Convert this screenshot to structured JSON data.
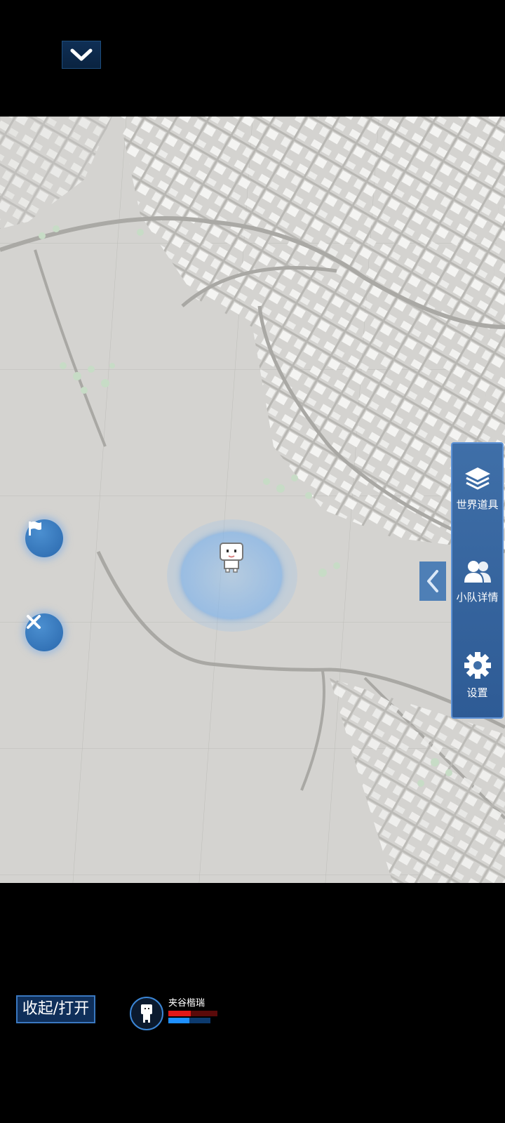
{
  "top": {
    "collapse_icon": "chevron-down-icon"
  },
  "map": {
    "player_marker": "player-avatar",
    "left_buttons": [
      {
        "name": "flag-button",
        "icon": "flag-icon"
      },
      {
        "name": "close-button",
        "icon": "close-icon"
      }
    ]
  },
  "side_panel": {
    "items": [
      {
        "label": "世界道具",
        "icon": "layers-icon"
      },
      {
        "label": "小队详情",
        "icon": "team-icon"
      },
      {
        "label": "设置",
        "icon": "gear-icon"
      }
    ],
    "collapse_icon": "chevron-left-icon"
  },
  "bottom": {
    "toggle_label": "收起/打开",
    "member": {
      "name": "夹谷楷瑞",
      "hp_fraction": 0.45,
      "mp_fraction": 0.5
    }
  },
  "colors": {
    "panel": "#3f6fa8",
    "accent": "#3b86d6",
    "hp": "#e01818",
    "mp": "#1e90ff"
  }
}
